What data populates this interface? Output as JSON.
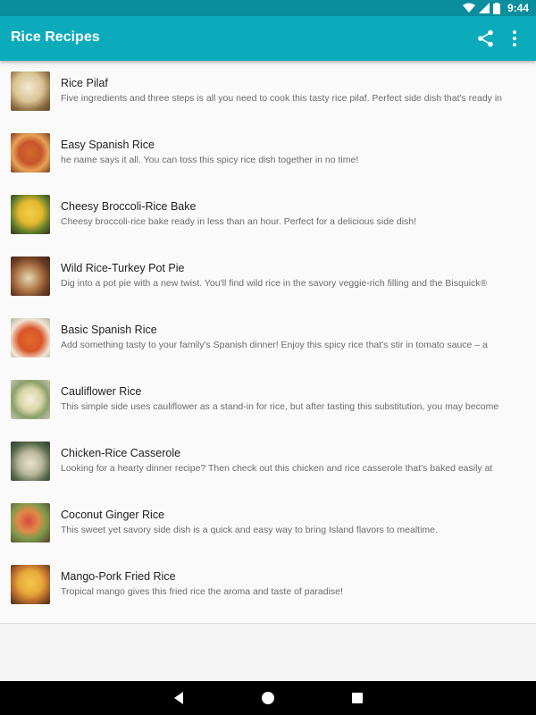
{
  "status_bar": {
    "time": "9:44"
  },
  "app": {
    "title": "Rice Recipes"
  },
  "recipes": [
    {
      "title": "Rice Pilaf",
      "description": "Five ingredients and three steps is all you need to cook this tasty rice pilaf. Perfect side dish that's ready in"
    },
    {
      "title": "Easy Spanish Rice",
      "description": "he name says it all. You can toss this spicy rice dish together in no time!"
    },
    {
      "title": "Cheesy Broccoli-Rice Bake",
      "description": "Cheesy broccoli-rice bake ready in less than an hour. Perfect for a delicious side dish!"
    },
    {
      "title": "Wild Rice-Turkey Pot Pie",
      "description": "Dig into a pot pie with a new twist. You'll find wild rice in the savory veggie-rich filling and the Bisquick®"
    },
    {
      "title": "Basic Spanish Rice",
      "description": "Add something tasty to your family's Spanish dinner! Enjoy this spicy rice that's stir in tomato sauce – a"
    },
    {
      "title": "Cauliflower Rice",
      "description": "This simple side uses cauliflower as a stand-in for rice, but after tasting this substitution, you may become"
    },
    {
      "title": "Chicken-Rice Casserole",
      "description": "Looking for a hearty dinner recipe? Then check out this chicken and rice casserole that's baked easily at"
    },
    {
      "title": "Coconut Ginger Rice",
      "description": "This sweet yet savory side dish is a quick and easy way to bring Island flavors to mealtime."
    },
    {
      "title": "Mango-Pork Fried Rice",
      "description": "Tropical mango gives this fried rice the aroma and taste of paradise!"
    }
  ]
}
